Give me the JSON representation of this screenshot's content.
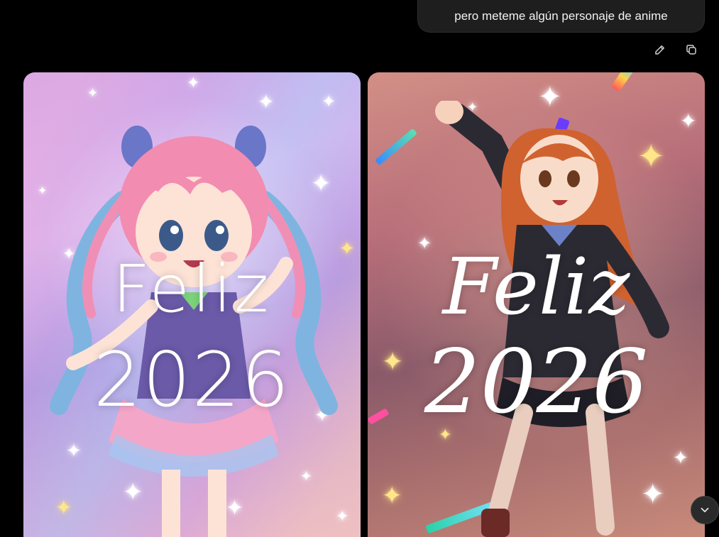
{
  "user_message": {
    "text": "pero meteme algún personaje de anime"
  },
  "message_actions": {
    "edit_icon": "pencil-icon",
    "copy_icon": "copy-icon"
  },
  "images": [
    {
      "greeting_line1": "Feliz",
      "greeting_line2": "2026"
    },
    {
      "greeting_line1": "Feliz",
      "greeting_line2": "2026"
    }
  ],
  "scroll_button": {
    "icon": "chevron-down-icon"
  },
  "colors": {
    "background": "#000000",
    "bubble": "#1e1e1e",
    "left_card_accent": "#c9a2e6",
    "right_card_accent": "#b86f7a"
  }
}
